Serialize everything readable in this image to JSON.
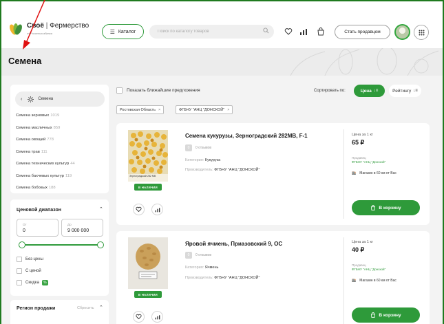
{
  "header": {
    "logo_brand": "Своё",
    "logo_separator": "|",
    "logo_product": "Фермерство",
    "logo_sub": "от Россельхозбанка",
    "catalog_label": "Каталог",
    "search_placeholder": "Поиск по каталогу товаров",
    "become_seller_label": "Стать продавцом"
  },
  "page": {
    "title": "Семена"
  },
  "sidebar": {
    "back_label": "Семена",
    "categories": [
      {
        "name": "Семена зерновых",
        "count": "1019"
      },
      {
        "name": "Семена масличных",
        "count": "859"
      },
      {
        "name": "Семена овощей",
        "count": "778"
      },
      {
        "name": "Семена трав",
        "count": "111"
      },
      {
        "name": "Семена технических культур",
        "count": "44"
      },
      {
        "name": "Семена бахчевых культур",
        "count": "119"
      },
      {
        "name": "Семена бобовых",
        "count": "188"
      }
    ],
    "price_filter": {
      "title": "Ценовой диапазон",
      "from_label": "От",
      "from_value": "0",
      "to_label": "До",
      "to_value": "9 000 000",
      "options": [
        "Без цены",
        "С ценой",
        "Скидка"
      ],
      "discount_badge": "%"
    },
    "region": {
      "title": "Регион продажи",
      "reset_label": "Сбросить"
    }
  },
  "controls": {
    "nearby_label": "Показать ближайшие предложения",
    "sort_label": "Сортировать по:",
    "sort_price": "Цена",
    "sort_rating": "Рейтингу",
    "tags": [
      "Ростовская Область",
      "ФГБНУ \"АНЦ \"ДОНСКОЙ\""
    ],
    "tag_close": "×"
  },
  "products": [
    {
      "name": "Семена кукурузы, Зерноградский 282МВ, F-1",
      "rating": "0",
      "reviews": "0 отзывов",
      "category_label": "Категория:",
      "category": "Кукуруза",
      "producer_label": "Производитель:",
      "producer": "ФГБНУ \"АНЦ \"ДОНСКОЙ\"",
      "image_caption": "Зерноградский 282 МВ",
      "stock": "В НАЛИЧИИ",
      "price_label": "Цена за 1 кг",
      "price": "65 ₽",
      "seller_label": "Продавец",
      "seller": "ФГБНУ \"АНЦ \"Донской\"",
      "store": "Магазин в 60 км от Вас",
      "cart_label": "В корзину"
    },
    {
      "name": "Яровой ячмень, Приазовский 9, ОС",
      "rating": "0",
      "reviews": "0 отзывов",
      "category_label": "Категория:",
      "category": "Ячмень",
      "producer_label": "Производитель:",
      "producer": "ФГБНУ \"АНЦ \"ДОНСКОЙ\"",
      "stock": "В НАЛИЧИИ",
      "price_label": "Цена за 1 кг",
      "price": "40 ₽",
      "seller_label": "Продавец",
      "seller": "ФГБНУ \"АНЦ \"Донской\"",
      "store": "Магазин в 60 км от Вас",
      "cart_label": "В корзину"
    }
  ],
  "colors": {
    "accent": "#2e9a3a",
    "frame": "#1f7a1f",
    "annotation": "#e01010"
  }
}
